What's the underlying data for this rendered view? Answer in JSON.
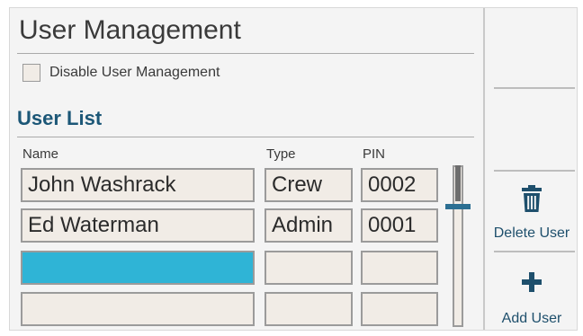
{
  "header": {
    "title": "User Management"
  },
  "options": {
    "disable_label": "Disable User Management",
    "disable_checked": false
  },
  "user_list": {
    "title": "User List",
    "columns": [
      "Name",
      "Type",
      "PIN"
    ],
    "rows": [
      {
        "name": "John Washrack",
        "type": "Crew",
        "pin": "0002"
      },
      {
        "name": "Ed Waterman",
        "type": "Admin",
        "pin": "0001"
      },
      {
        "name": "",
        "type": "",
        "pin": ""
      },
      {
        "name": "",
        "type": "",
        "pin": ""
      }
    ]
  },
  "actions": {
    "delete_label": "Delete User",
    "add_label": "Add User"
  },
  "colors": {
    "accent": "#2fb4d6",
    "heading": "#1c5777",
    "cell_bg": "#f1ece6"
  },
  "icons": {
    "delete": "trash-icon",
    "add": "plus-icon"
  }
}
